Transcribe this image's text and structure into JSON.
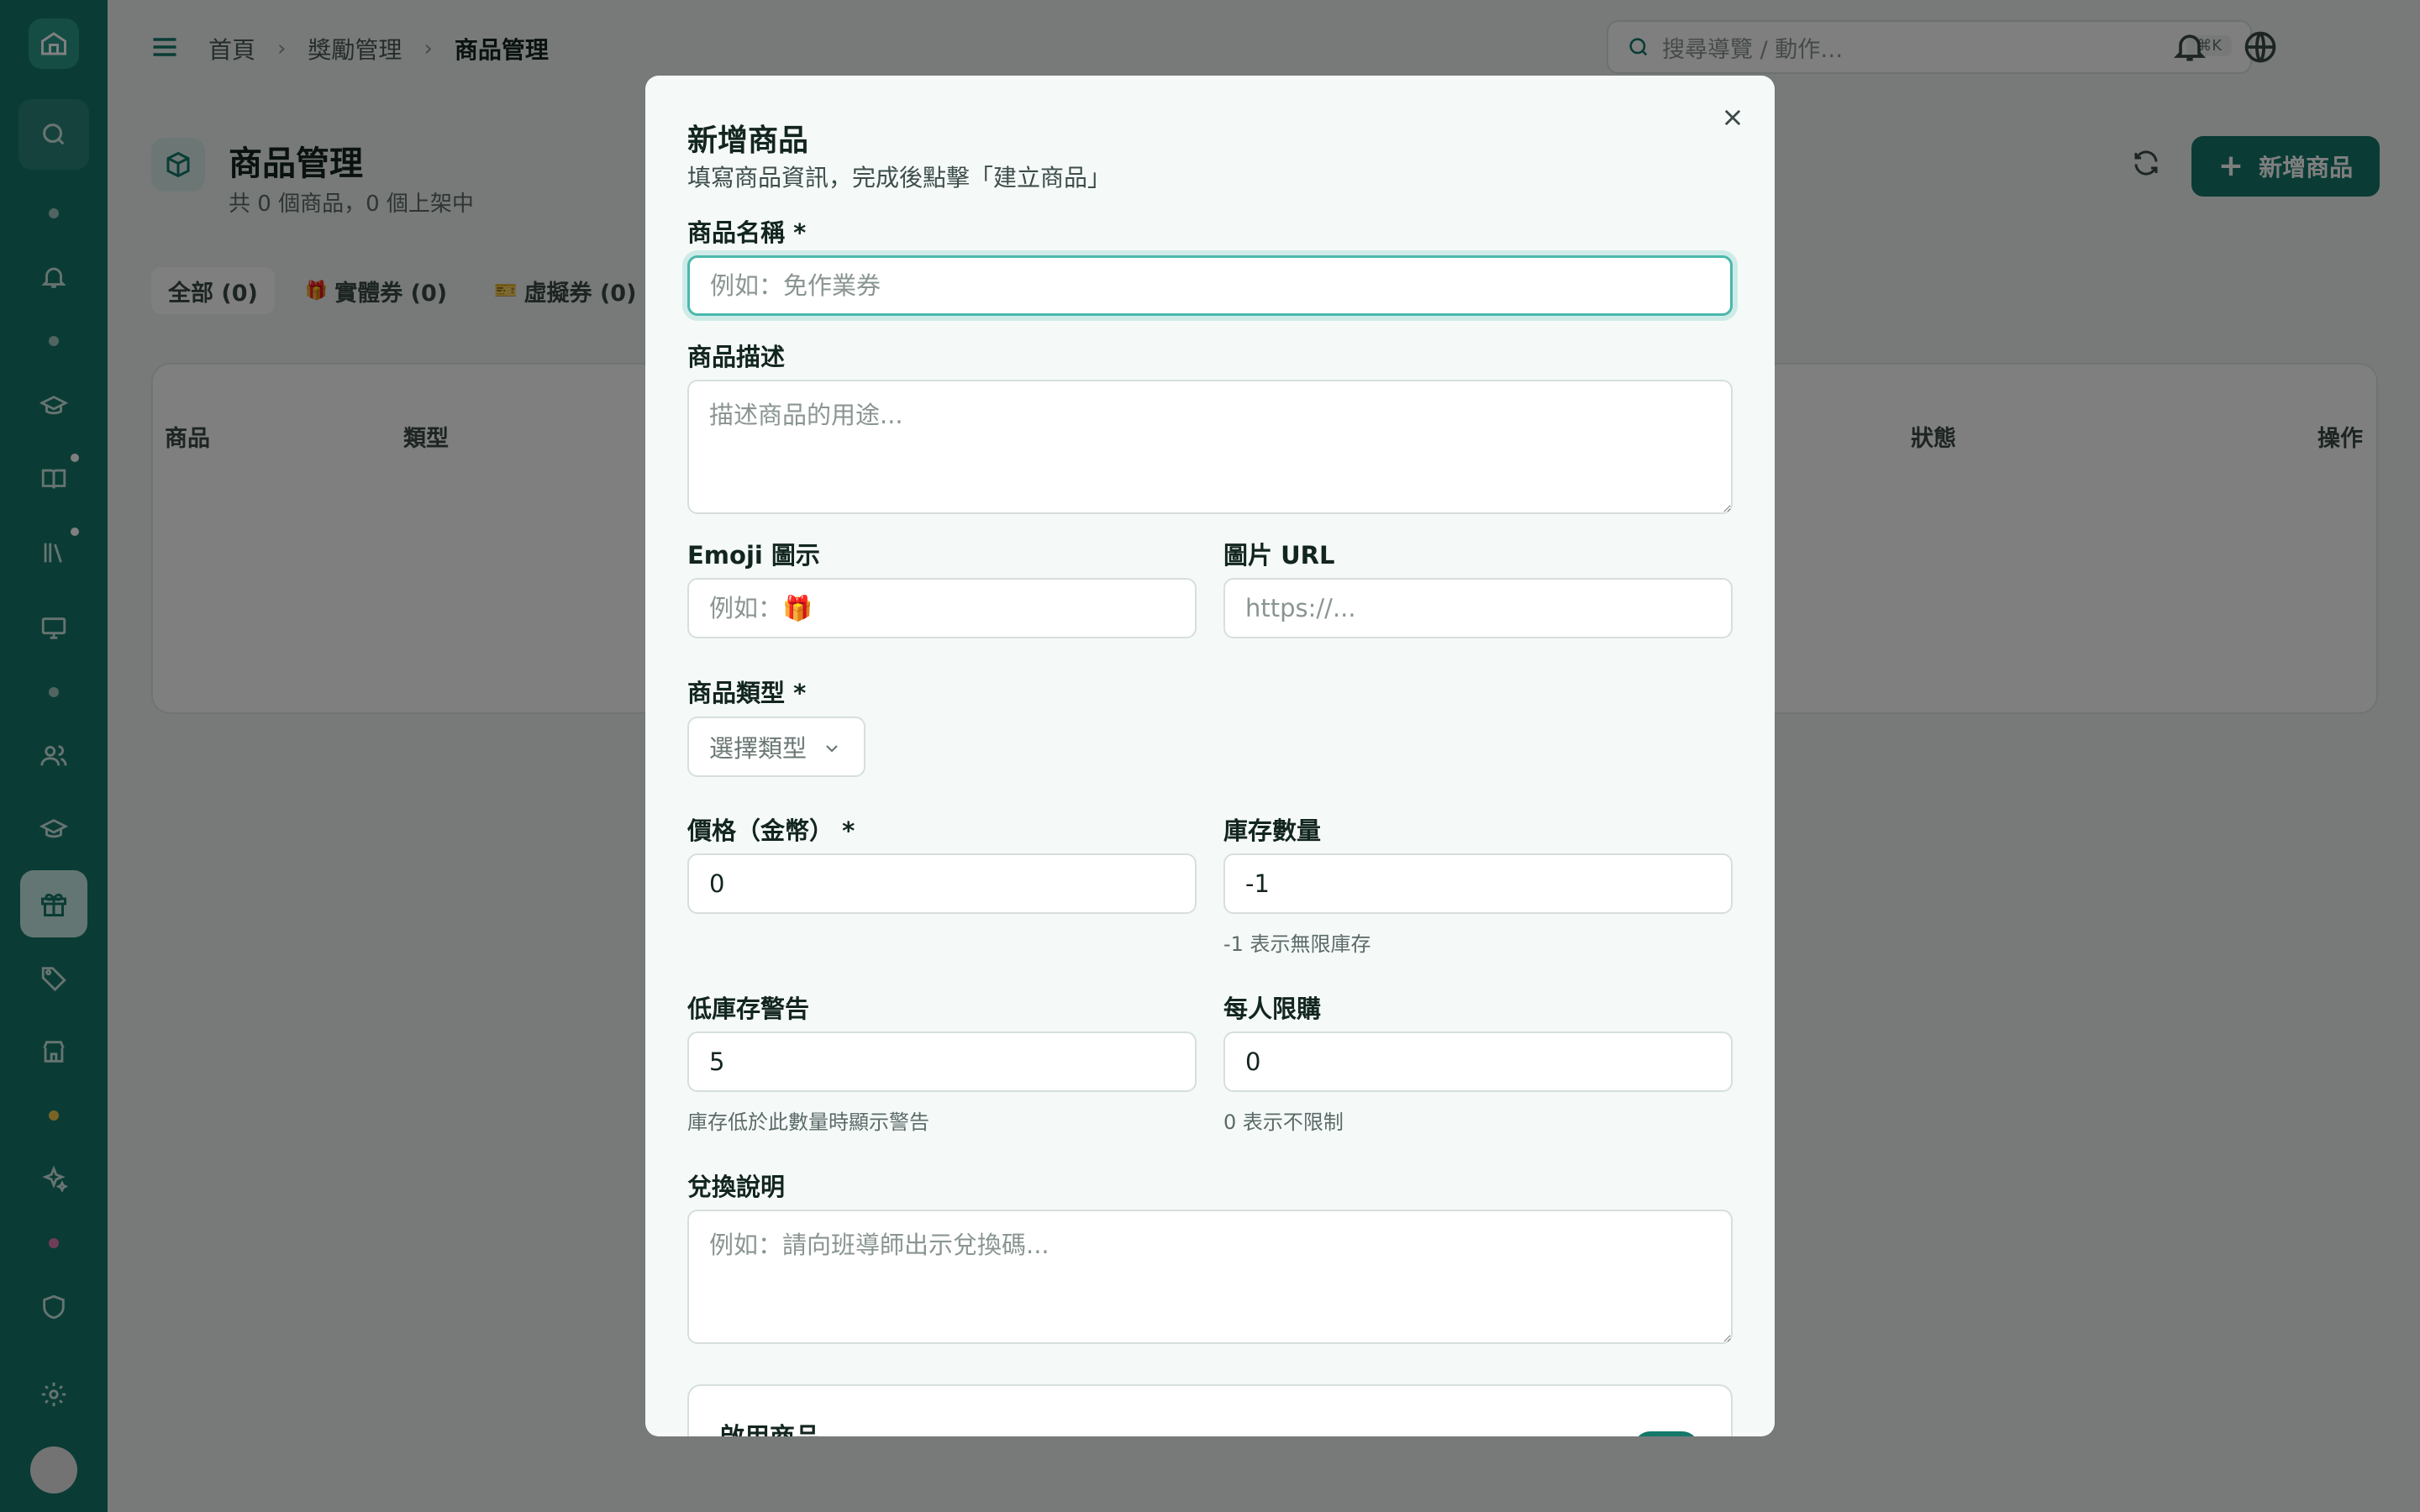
{
  "breadcrumb": {
    "home": "首頁",
    "section": "獎勵管理",
    "current": "商品管理"
  },
  "search": {
    "placeholder": "搜尋導覽 / 動作…",
    "shortcut": "⌘K"
  },
  "page": {
    "title": "商品管理",
    "subtitle": "共 0 個商品，0 個上架中",
    "add_button": "新增商品"
  },
  "filters": [
    {
      "label": "全部 (0)",
      "emoji": ""
    },
    {
      "label": "實體券 (0)",
      "emoji": "🎁"
    },
    {
      "label": "虛擬券 (0)",
      "emoji": "🎫"
    }
  ],
  "table": {
    "columns": [
      "商品",
      "類型",
      "狀態",
      "操作"
    ]
  },
  "modal": {
    "title": "新增商品",
    "description": "填寫商品資訊，完成後點擊「建立商品」",
    "name": {
      "label": "商品名稱 *",
      "placeholder": "例如：免作業券",
      "value": ""
    },
    "desc": {
      "label": "商品描述",
      "placeholder": "描述商品的用途..."
    },
    "emoji": {
      "label": "Emoji 圖示",
      "placeholder": "例如：🎁"
    },
    "image_url": {
      "label": "圖片 URL",
      "placeholder": "https://..."
    },
    "type": {
      "label": "商品類型 *",
      "placeholder": "選擇類型"
    },
    "price": {
      "label": "價格（金幣） *",
      "value": "0"
    },
    "stock": {
      "label": "庫存數量",
      "value": "-1",
      "hint": "-1 表示無限庫存"
    },
    "low_stock": {
      "label": "低庫存警告",
      "value": "5",
      "hint": "庫存低於此數量時顯示警告"
    },
    "limit": {
      "label": "每人限購",
      "value": "0",
      "hint": "0 表示不限制"
    },
    "redeem": {
      "label": "兌換說明",
      "placeholder": "例如：請向班導師出示兌換碼..."
    },
    "enable": {
      "label": "啟用商品",
      "on": true
    }
  },
  "colors": {
    "primary": "#14786a",
    "focus": "#4ab8ac",
    "modal_bg": "#f5faf9"
  }
}
